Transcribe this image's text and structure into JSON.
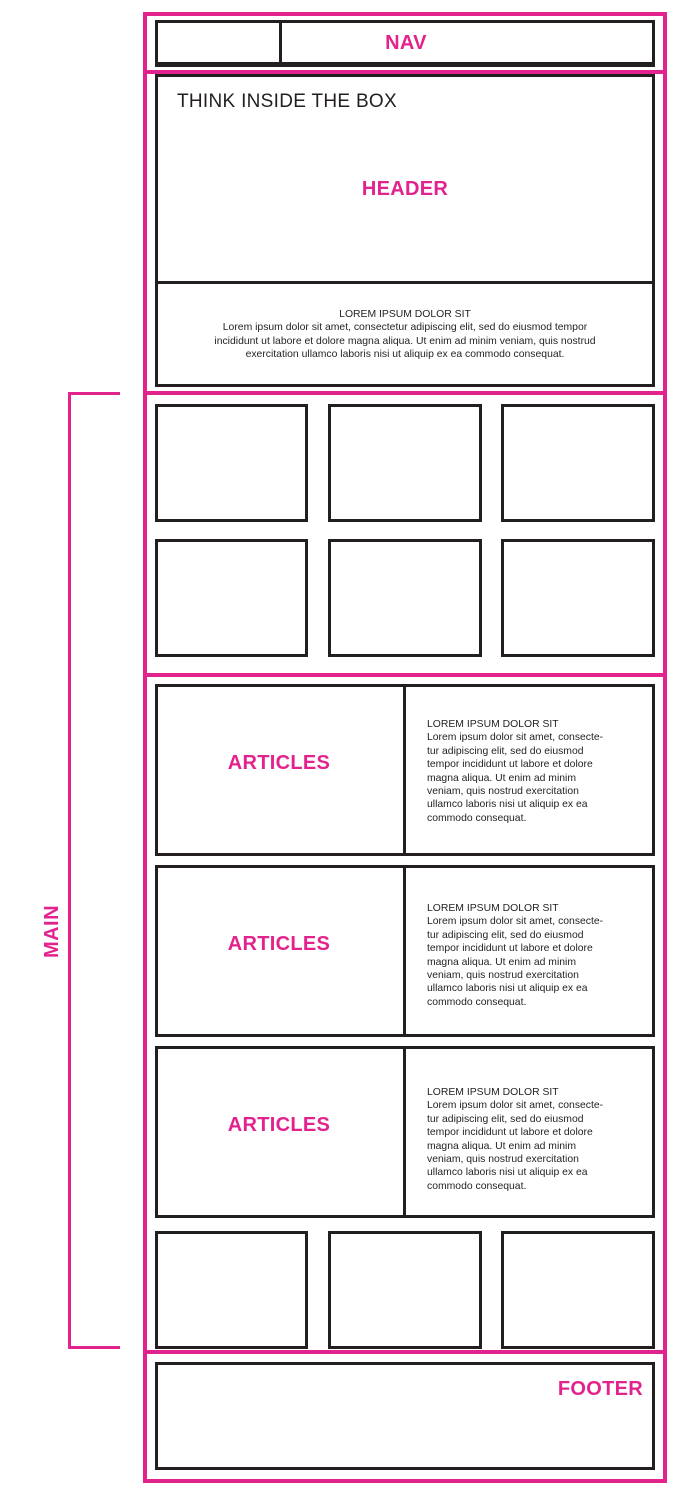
{
  "labels": {
    "nav": "NAV",
    "header": "HEADER",
    "main": "MAIN",
    "footer": "FOOTER",
    "article": "ARTICLES"
  },
  "header_title": "THINK INSIDE THE BOX",
  "header_text": {
    "heading": "LOREM IPSUM DOLOR SIT",
    "lines": [
      "Lorem ipsum dolor sit amet, consectetur adipiscing elit, sed do eiusmod tempor",
      "incididunt ut labore et dolore magna aliqua. Ut enim ad minim veniam, quis nostrud",
      "exercitation ullamco laboris nisi ut aliquip ex ea commodo consequat."
    ]
  },
  "articles": [
    {
      "heading": "LOREM IPSUM DOLOR SIT",
      "lines": [
        "Lorem ipsum dolor sit amet, consecte-",
        "tur adipiscing elit, sed do eiusmod",
        "tempor incididunt ut labore et dolore",
        "magna aliqua. Ut enim ad minim",
        "veniam, quis nostrud exercitation",
        "ullamco laboris nisi ut aliquip ex ea",
        "commodo consequat."
      ]
    },
    {
      "heading": "LOREM IPSUM DOLOR SIT",
      "lines": [
        "Lorem ipsum dolor sit amet, consecte-",
        "tur adipiscing elit, sed do eiusmod",
        "tempor incididunt ut labore et dolore",
        "magna aliqua. Ut enim ad minim",
        "veniam, quis nostrud exercitation",
        "ullamco laboris nisi ut aliquip ex ea",
        "commodo consequat."
      ]
    },
    {
      "heading": "LOREM IPSUM DOLOR SIT",
      "lines": [
        "Lorem ipsum dolor sit amet, consecte-",
        "tur adipiscing elit, sed do eiusmod",
        "tempor incididunt ut labore et dolore",
        "magna aliqua. Ut enim ad minim",
        "veniam, quis nostrud exercitation",
        "ullamco laboris nisi ut aliquip ex ea",
        "commodo consequat."
      ]
    }
  ],
  "colors": {
    "accent": "#e3238d",
    "outline": "#231f20"
  }
}
